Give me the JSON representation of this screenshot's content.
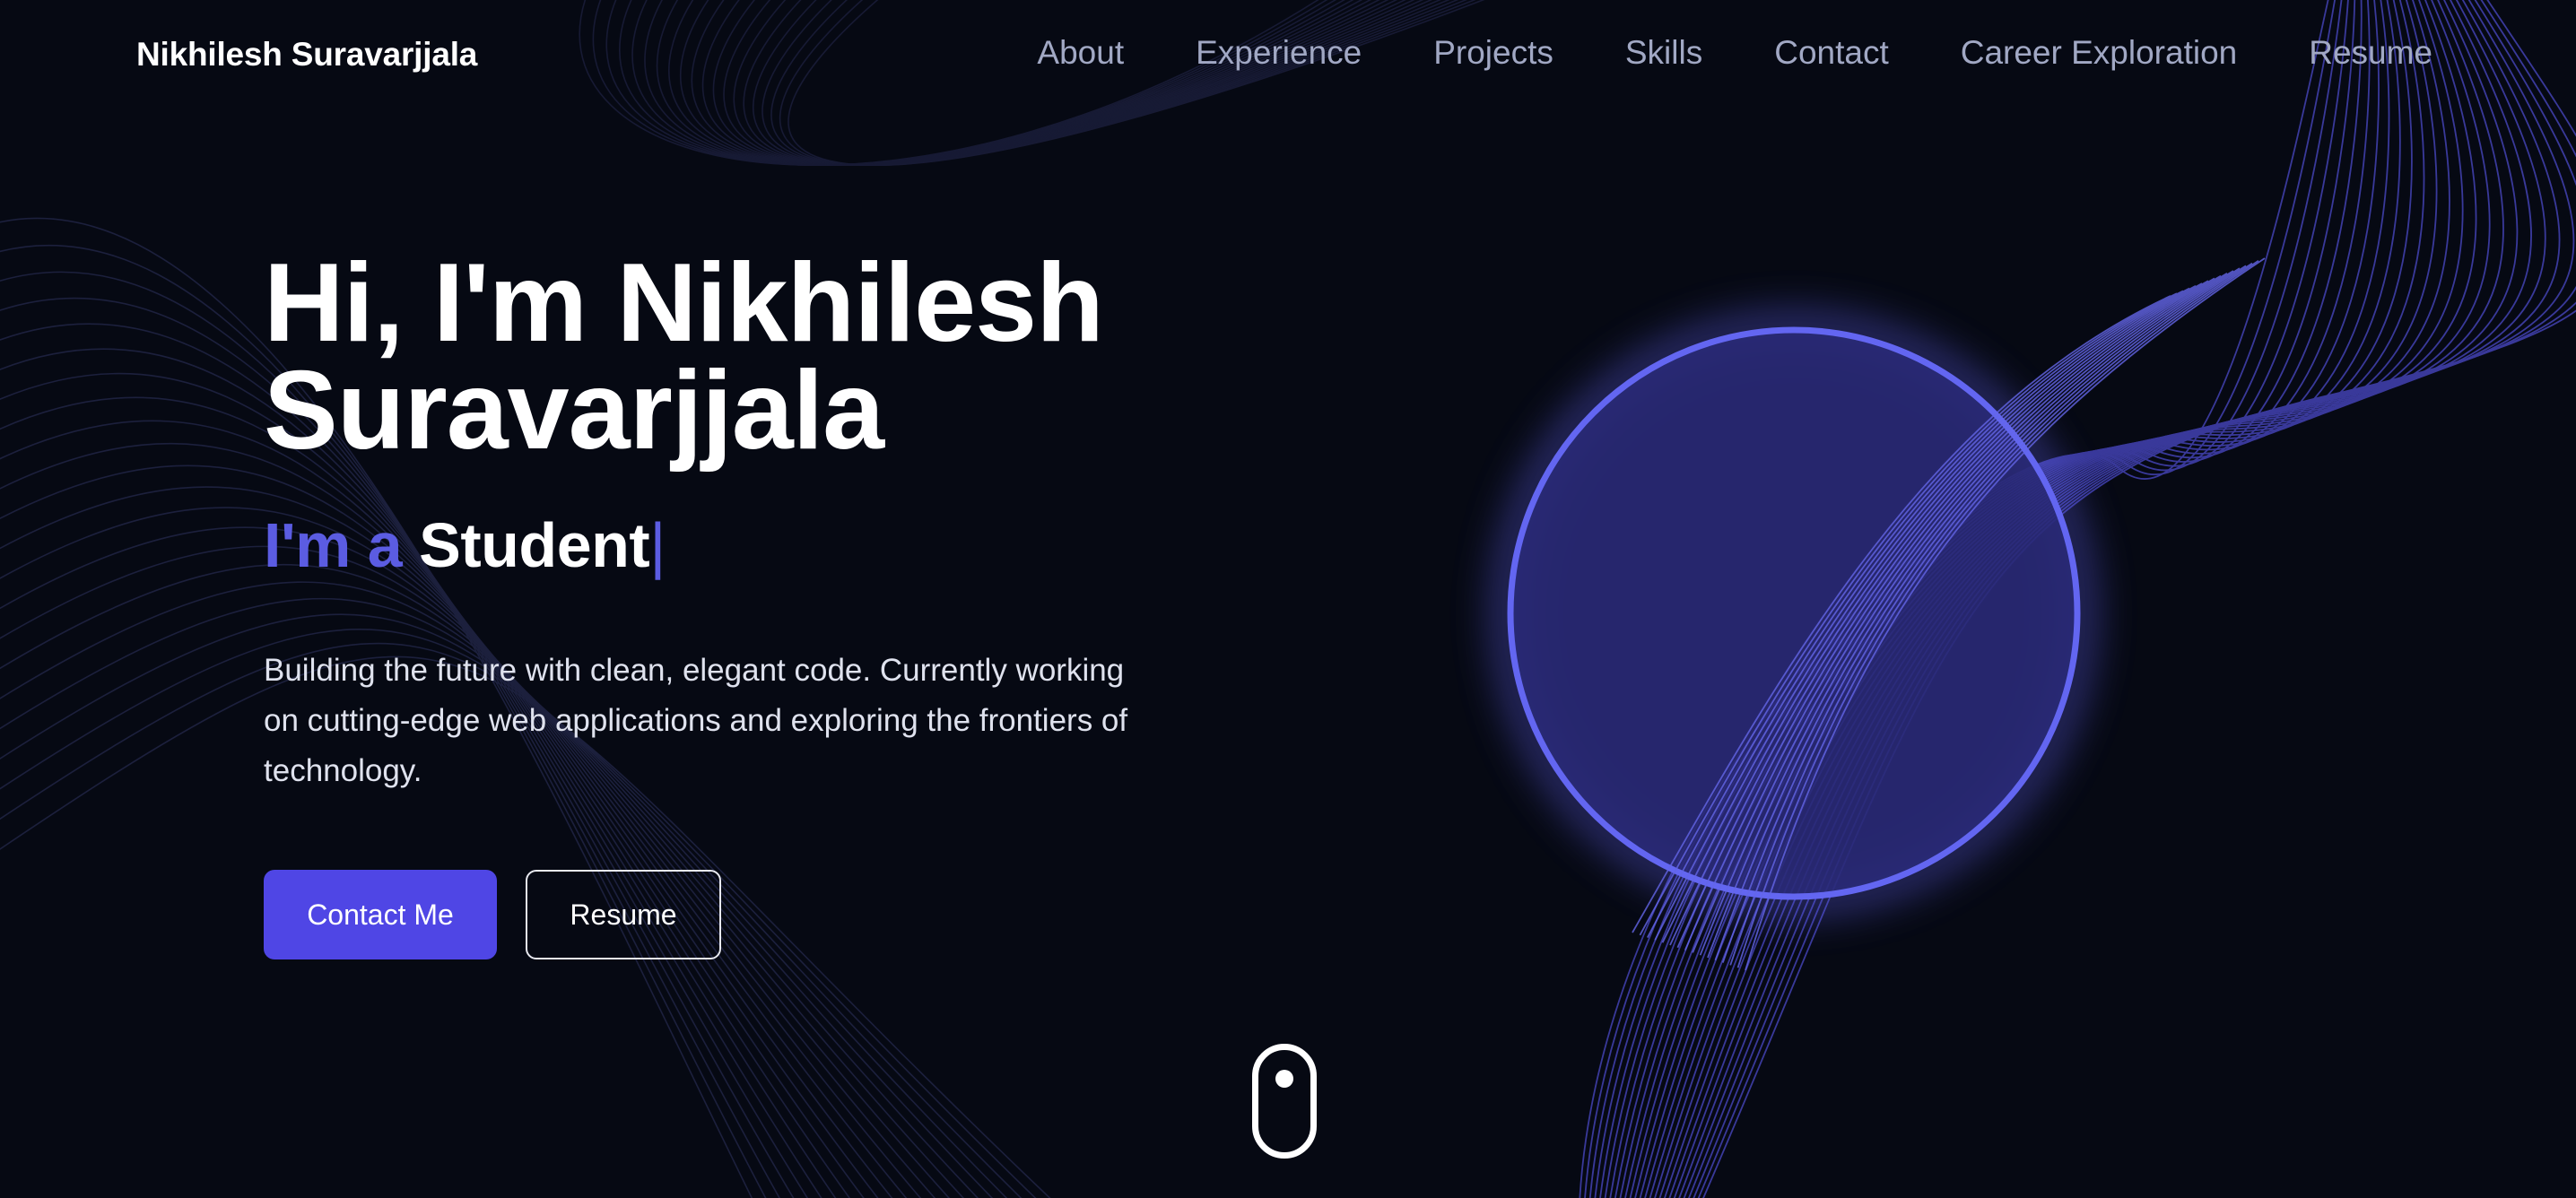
{
  "colors": {
    "background": "#060913",
    "accent": "#5b5ce2",
    "button_primary": "#4f46e5",
    "nav_link": "#a1a8c4",
    "orb_ring": "#6366f1"
  },
  "header": {
    "brand": "Nikhilesh Suravarjjala",
    "nav": [
      {
        "label": "About"
      },
      {
        "label": "Experience"
      },
      {
        "label": "Projects"
      },
      {
        "label": "Skills"
      },
      {
        "label": "Contact"
      },
      {
        "label": "Career Exploration"
      },
      {
        "label": "Resume"
      }
    ]
  },
  "hero": {
    "title_line1": "Hi, I'm Nikhilesh",
    "title_line2": "Suravarjjala",
    "typed_prefix": "I'm a ",
    "typed_role": "Student",
    "typed_cursor": "|",
    "description": "Building the future with clean, elegant code. Currently working on cutting-edge web applications and exploring the frontiers of technology.",
    "primary_button": "Contact Me",
    "secondary_button": "Resume"
  },
  "icons": {
    "scroll": "mouse-scroll-icon"
  }
}
